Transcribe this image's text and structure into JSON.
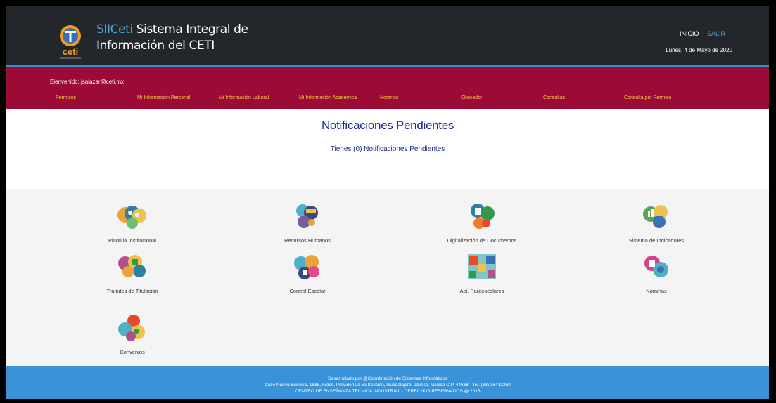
{
  "header": {
    "brand_acronym": "SIICeti",
    "brand_line1": " Sistema Integral de",
    "brand_line2": "Información del CETI",
    "logo_text": "ceti",
    "links": {
      "inicio": "INICIO",
      "salir": "SALIR"
    },
    "date": "Lunes, 4 de Mayo de 2020"
  },
  "nav": {
    "welcome": "Bienvenido: jsalazar@ceti.mx",
    "items": [
      "Permisos",
      "Mi Información Personal",
      "Mi Información Laboral",
      "Mi Información Académica",
      "Horarios",
      "Checador",
      "Consultas",
      "Consulta por Permiso"
    ]
  },
  "notifications": {
    "title": "Notificaciones Pendientes",
    "message": "Tienes (0) Notificaciones Pendientes"
  },
  "modules": [
    {
      "label": "Plantilla Institucional",
      "icon": "plantilla-icon"
    },
    {
      "label": "Recursos Humanos",
      "icon": "recursos-humanos-icon"
    },
    {
      "label": "Digitalización de Documentos",
      "icon": "digitalizacion-icon"
    },
    {
      "label": "Sistema de Indicadores",
      "icon": "indicadores-icon"
    },
    {
      "label": "Tramites de Titulación",
      "icon": "titulacion-icon"
    },
    {
      "label": "Control Escolar",
      "icon": "control-escolar-icon"
    },
    {
      "label": "Act. Paraescolares",
      "icon": "paraescolares-icon"
    },
    {
      "label": "Nóminas",
      "icon": "nominas-icon"
    },
    {
      "label": "Convenios",
      "icon": "convenios-icon"
    }
  ],
  "footer": {
    "line1": "Desarrollado por @Coordinación de Sistemas Informáticos",
    "line2": "Calle Nueva Escocia, 1885, Fracc. Providencia 5a Sección, Guadalajara, Jalisco, México C.P. 44638 - Tel. (33) 36413250",
    "line3": "CENTRO DE ENSEÑANZA TECNICA INDUSTRIAL - DERECHOS RESERVADOS @ 2018"
  },
  "colors": {
    "header_bg": "#23272b",
    "accent_blue": "#3a92d8",
    "nav_maroon": "#9b0b36",
    "nav_link_yellow": "#f7c94a",
    "title_blue": "#1a2a8f"
  }
}
